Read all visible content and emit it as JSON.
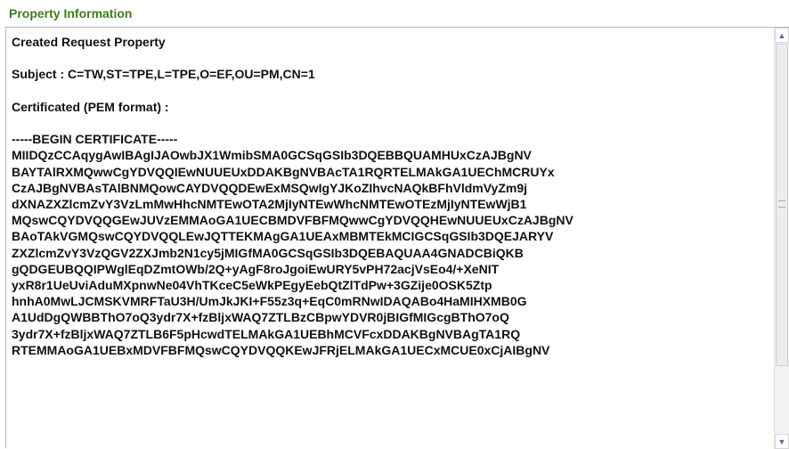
{
  "header": {
    "title": "Property Information"
  },
  "content": {
    "heading": "Created Request Property",
    "subject": "Subject : C=TW,ST=TPE,L=TPE,O=EF,OU=PM,CN=1",
    "cert_label": "Certificated (PEM format) :",
    "cert_lines": [
      "-----BEGIN CERTIFICATE-----",
      "MIIDQzCCAqygAwIBAgIJAOwbJX1WmibSMA0GCSqGSIb3DQEBBQUAMHUxCzAJBgNV",
      "BAYTAlRXMQwwCgYDVQQIEwNUUEUxDDAKBgNVBAcTA1RQRTELMAkGA1UEChMCRUYx",
      "CzAJBgNVBAsTAlBNMQowCAYDVQQDEwExMSQwIgYJKoZIhvcNAQkBFhVldmVyZm9j",
      "dXNAZXZlcmZvY3VzLmMwHhcNMTEwOTA2MjIyNTEwWhcNMTEwOTEzMjIyNTEwWjB1",
      "MQswCQYDVQQGEwJUVzEMMAoGA1UECBMDVFBFMQwwCgYDVQQHEwNUUEUxCzAJBgNV",
      "BAoTAkVGMQswCQYDVQQLEwJQTTEKMAgGA1UEAxMBMTEkMCIGCSqGSIb3DQEJARYV",
      "ZXZlcmZvY3VzQGV2ZXJmb2N1cy5jMIGfMA0GCSqGSIb3DQEBAQUAA4GNADCBiQKB",
      "gQDGEUBQQIPWglEqDZmtOWb/2Q+yAgF8roJgoiEwURY5vPH72acjVsEo4/+XeNIT",
      "yxR8r1UeUviAduMXpnwNe04VhTKceC5eWkPEgyEebQtZlTdPw+3GZije0OSK5Ztp",
      "hnhA0MwLJCMSKVMRFTaU3H/UmJkJKI+F55z3q+EqC0mRNwIDAQABo4HaMIHXMB0G",
      "A1UdDgQWBBThO7oQ3ydr7X+fzBljxWAQ7ZTLBzCBpwYDVR0jBIGfMIGcgBThO7oQ",
      "3ydr7X+fzBljxWAQ7ZTLB6F5pHcwdTELMAkGA1UEBhMCVFcxDDAKBgNVBAgTA1RQ",
      "RTEMMAoGA1UEBxMDVFBFMQswCQYDVQQKEwJFRjELMAkGA1UECxMCUE0xCjAIBgNV"
    ]
  },
  "scrollbar": {
    "up_icon": "triangle-up-icon",
    "down_icon": "triangle-down-icon",
    "position": 0.0
  }
}
